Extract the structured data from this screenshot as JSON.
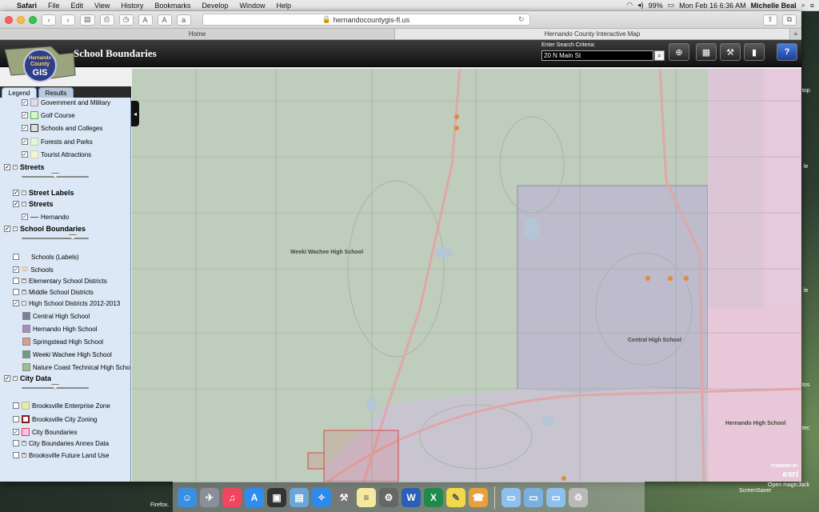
{
  "menubar": {
    "apple": "",
    "app": "Safari",
    "items": [
      "File",
      "Edit",
      "View",
      "History",
      "Bookmarks",
      "Develop",
      "Window",
      "Help"
    ],
    "battery": "99%",
    "datetime": "Mon Feb 16  6:36 AM",
    "user": "Michelle Beal"
  },
  "browser": {
    "url": "hernandocountygis-fl.us",
    "tabs": [
      "Home",
      "Hernando County Interactive Map"
    ],
    "new_tab": "+"
  },
  "app": {
    "title": "School Boundaries",
    "logo_text": [
      "Hernando",
      "County",
      "GIS"
    ],
    "search_label": "Enter Search Criteria:",
    "search_value": "20 N Main St",
    "help": "?"
  },
  "panel": {
    "tabs": [
      "Legend",
      "Results"
    ],
    "partial_top": "Government and Military",
    "places": [
      "Golf Course",
      "Schools and Colleges",
      "Forests and Parks",
      "Tourist Attractions"
    ],
    "streets_group": "Streets",
    "street_labels": "Street Labels",
    "streets_sub": "Streets",
    "hernando": "Hernando",
    "school_group": "School Boundaries",
    "schools_labels": "Schools (Labels)",
    "schools": "Schools",
    "elementary": "Elementary School Districts",
    "middle": "Middle School Districts",
    "high": "High School Districts 2012-2013",
    "high_schools": [
      {
        "name": "Central High School",
        "color": "#777f9a"
      },
      {
        "name": "Hernando High School",
        "color": "#a88ac0"
      },
      {
        "name": "Springstead High School",
        "color": "#e29a8a"
      },
      {
        "name": "Weeki Wachee High School",
        "color": "#6f9a86"
      },
      {
        "name": "Nature Coast Technical High School",
        "color": "#9ac092"
      }
    ],
    "city_group": "City Data",
    "enterprise": "Brooksville Enterprise Zone",
    "zoning": "Brooksville City Zoning",
    "city_boundaries": "City Boundaries",
    "annex": "City Boundaries Annex Data",
    "future_land": "Brooksville Future Land Use"
  },
  "map": {
    "labels": {
      "weeki": "Weeki Wachee High School",
      "central": "Central High School",
      "hernando": "Hernando High School"
    },
    "esri_powered": "POWERED BY",
    "esri": "esri"
  },
  "desktop": {
    "firefox": "Firefox.",
    "screensaver": "ScreenSaver",
    "open_magic": "Open magicJack",
    "edge_items": [
      "top",
      "le",
      "le",
      "tos",
      "tec"
    ]
  },
  "colors": {
    "map_base": "#c5d0c1",
    "weeki": "#b9cbb7",
    "central": "#bcb9cd",
    "hernando": "#e3bdd8",
    "roads": "#e8a4a4"
  }
}
